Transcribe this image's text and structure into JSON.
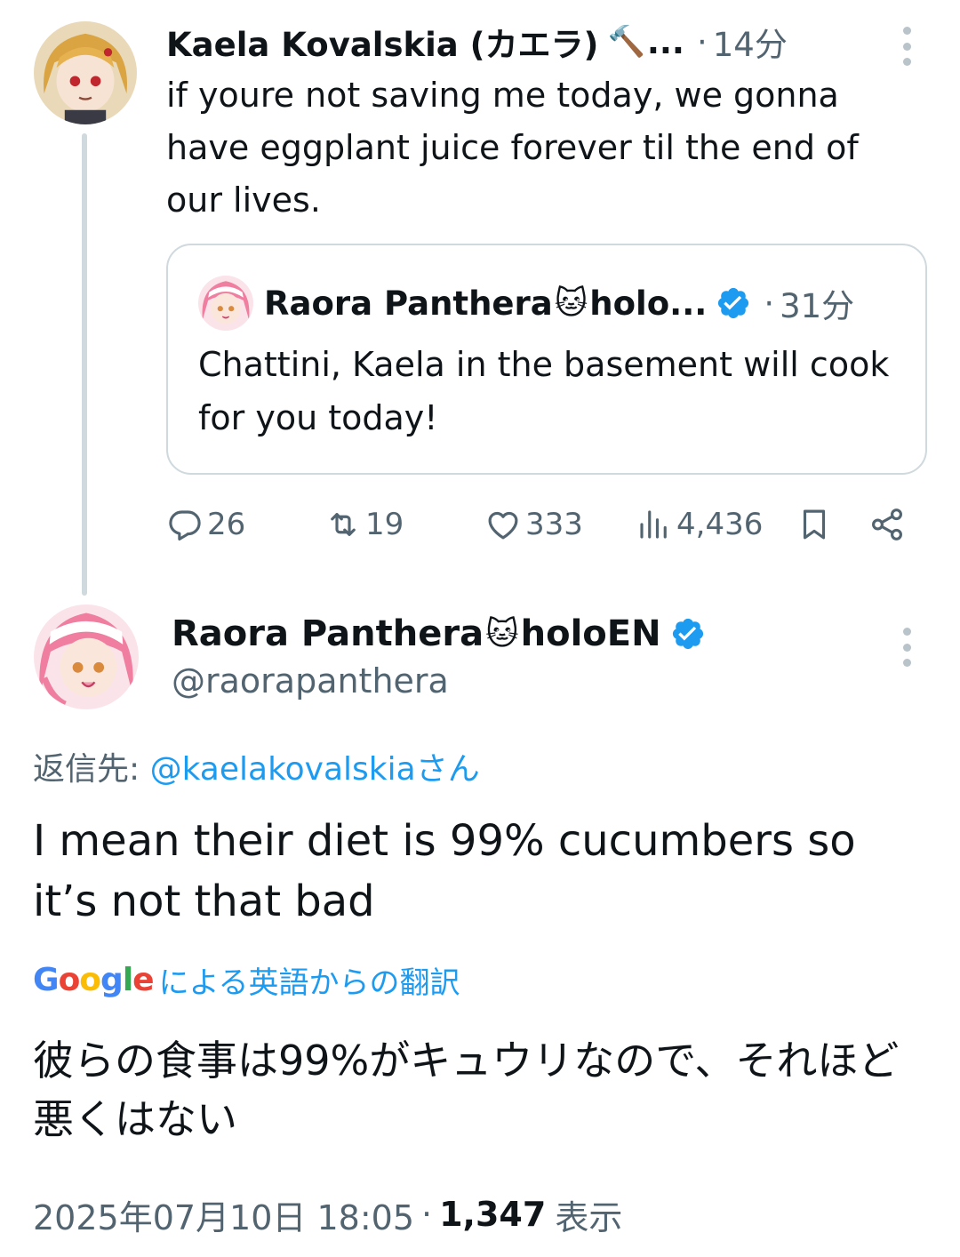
{
  "parent_tweet": {
    "author_name": "Kaela Kovalskia (カエラ)",
    "author_emoji": "🔨",
    "name_truncation": "...",
    "separator": "·",
    "time": "14分",
    "text": "if youre not saving me today, we gonna have eggplant juice forever til the end of our lives.",
    "quote": {
      "author_name": "Raora Panthera",
      "author_emoji": "🐱",
      "author_name_tail": "holo...",
      "separator": "·",
      "time": "31分",
      "text": "Chattini, Kaela in the basement will cook for you today!"
    },
    "stats": {
      "replies": "26",
      "retweets": "19",
      "likes": "333",
      "views": "4,436"
    }
  },
  "reply_tweet": {
    "author_name": "Raora Panthera",
    "author_emoji": "🐱",
    "author_name_tail": "holoEN",
    "handle": "@raorapanthera",
    "replying_prefix": "返信先: ",
    "replying_mention": "@kaelakovalskiaさん",
    "text": "I mean their diet is 99% cucumbers so it’s not that bad",
    "translation_label": "による英語からの翻訳",
    "translated_text": "彼らの食事は99%がキュウリなので、それほど悪くはない",
    "timestamp": "2025年07月10日 18:05",
    "separator": "·",
    "views": "1,347",
    "views_label": "表示"
  },
  "google_logo": {
    "letters": [
      "G",
      "o",
      "o",
      "g",
      "l",
      "e"
    ],
    "colors": [
      "#4285f4",
      "#ea4335",
      "#fbbc05",
      "#4285f4",
      "#34a853",
      "#ea4335"
    ]
  },
  "colors": {
    "text": "#0f1419",
    "secondary": "#536471",
    "link": "#1d9bf0",
    "verified": "#1d9bf0",
    "border": "#cfd9de"
  },
  "icons": [
    "reply-icon",
    "retweet-icon",
    "like-icon",
    "views-icon",
    "bookmark-icon",
    "share-icon",
    "verified-badge-icon",
    "more-options-icon"
  ]
}
